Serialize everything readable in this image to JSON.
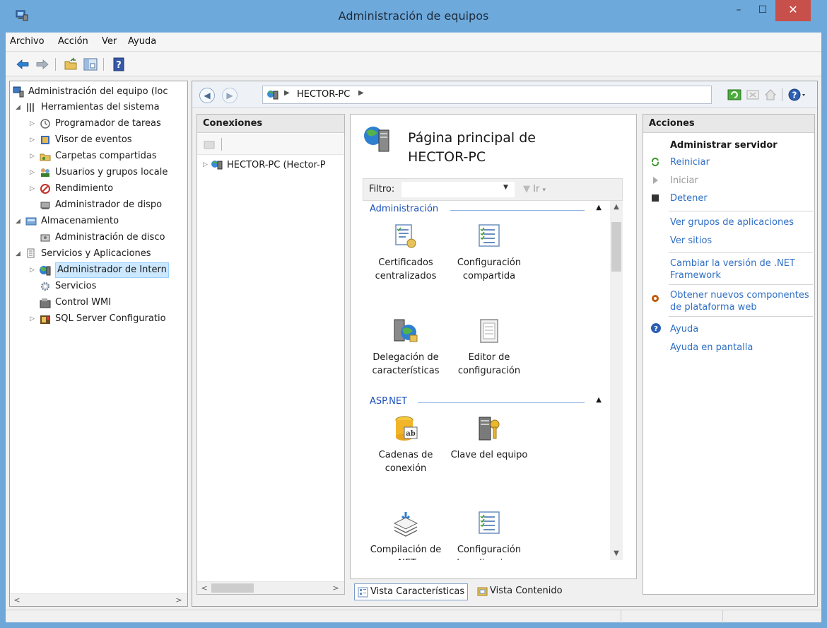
{
  "window": {
    "title": "Administración de equipos",
    "close_glyph": "✕",
    "minimize_glyph": "–",
    "maximize_glyph": "☐"
  },
  "menu": [
    "Archivo",
    "Acción",
    "Ver",
    "Ayuda"
  ],
  "toolbar": {
    "icons": [
      "back-arrow-icon",
      "forward-arrow-icon",
      "up-folder-icon",
      "show-hide-tree-icon",
      "help-icon"
    ]
  },
  "tree": {
    "root": "Administración del equipo (loc",
    "items": [
      {
        "label": "Herramientas del sistema",
        "level": 1,
        "expander": "◢"
      },
      {
        "label": "Programador de tareas",
        "level": 2,
        "expander": "▷"
      },
      {
        "label": "Visor de eventos",
        "level": 2,
        "expander": "▷"
      },
      {
        "label": "Carpetas compartidas",
        "level": 2,
        "expander": "▷"
      },
      {
        "label": "Usuarios y grupos locale",
        "level": 2,
        "expander": "▷"
      },
      {
        "label": "Rendimiento",
        "level": 2,
        "expander": "▷"
      },
      {
        "label": "Administrador de dispo",
        "level": 2,
        "expander": ""
      },
      {
        "label": "Almacenamiento",
        "level": 1,
        "expander": "◢"
      },
      {
        "label": "Administración de disco",
        "level": 2,
        "expander": ""
      },
      {
        "label": "Servicios y Aplicaciones",
        "level": 1,
        "expander": "◢"
      },
      {
        "label": "Administrador de Intern",
        "level": 2,
        "expander": "▷"
      },
      {
        "label": "Servicios",
        "level": 2,
        "expander": ""
      },
      {
        "label": "Control WMI",
        "level": 2,
        "expander": ""
      },
      {
        "label": "SQL Server Configuratio",
        "level": 2,
        "expander": "▷"
      }
    ]
  },
  "address": {
    "node": "HECTOR-PC"
  },
  "connections": {
    "header": "Conexiones",
    "node": "HECTOR-PC (Hector-P"
  },
  "features": {
    "title_line1": "Página principal de",
    "title_line2": "HECTOR-PC",
    "filter_label": "Filtro:",
    "filter_value": "",
    "go_label": "Ir",
    "groups": [
      {
        "name": "Administración",
        "items": [
          {
            "line1": "Certificados",
            "line2": "centralizados"
          },
          {
            "line1": "Configuración",
            "line2": "compartida"
          },
          {
            "line1": "Delegación de",
            "line2": "características"
          },
          {
            "line1": "Editor de",
            "line2": "configuración"
          }
        ]
      },
      {
        "name": "ASP.NET",
        "items": [
          {
            "line1": "Cadenas de",
            "line2": "conexión"
          },
          {
            "line1": "Clave del equipo",
            "line2": ""
          },
          {
            "line1": "Compilación de",
            "line2": ".NET"
          },
          {
            "line1": "Configuración",
            "line2": "de aplicaciones"
          }
        ]
      }
    ],
    "tab_features": "Vista Características",
    "tab_content": "Vista Contenido"
  },
  "actions": {
    "header": "Acciones",
    "title": "Administrar servidor",
    "restart": "Reiniciar",
    "start": "Iniciar",
    "stop": "Detener",
    "view_app_pools": "Ver grupos de aplicaciones",
    "view_sites": "Ver sitios",
    "change_net_1": "Cambiar la versión de .NET",
    "change_net_2": "Framework",
    "get_components_1": "Obtener nuevos componentes",
    "get_components_2": "de plataforma web",
    "help": "Ayuda",
    "online_help": "Ayuda en pantalla"
  },
  "colors": {
    "title_bar": "#6ea9dc",
    "close_button": "#c7504a",
    "link": "#2f6fc4",
    "group_header": "#1a4fba"
  }
}
